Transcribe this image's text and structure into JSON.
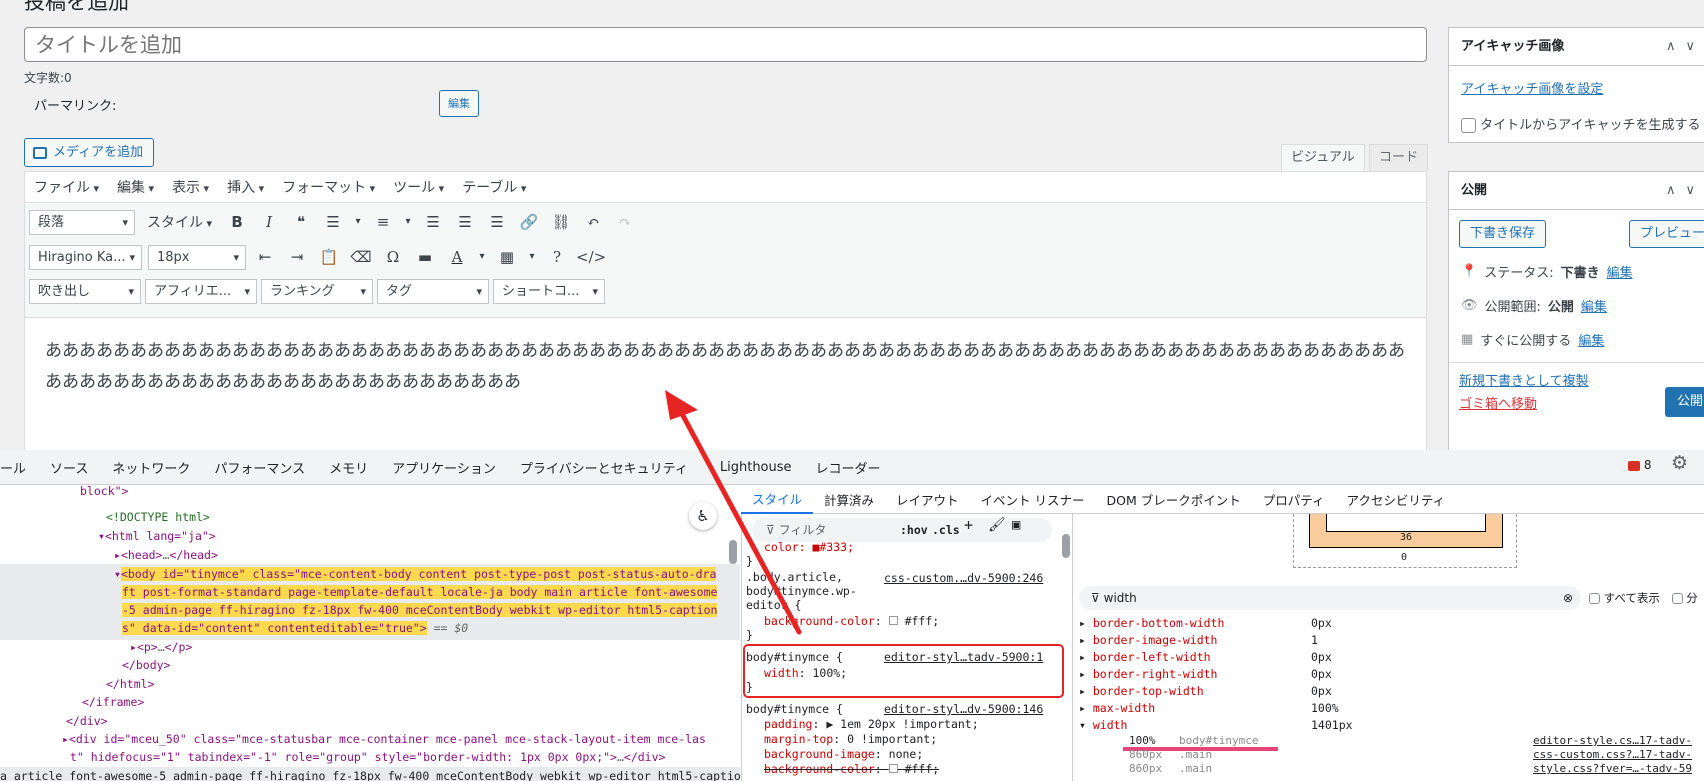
{
  "editor": {
    "heading": "投稿を追加",
    "title_placeholder": "タイトルを追加",
    "char_count": "文字数:0",
    "permalink_label": "パーマリンク:",
    "edit_button": "編集",
    "add_media": "メディアを追加",
    "tab_visual": "ビジュアル",
    "tab_code": "コード",
    "menu": [
      "ファイル",
      "編集",
      "表示",
      "挿入",
      "フォーマット",
      "ツール",
      "テーブル"
    ],
    "toolbar1": {
      "format_select": "段落",
      "style_dropdown": "スタイル"
    },
    "toolbar2": {
      "font_select": "Hiragino Ka...",
      "size_select": "18px"
    },
    "toolbar3": [
      "吹き出し",
      "アフィリエ...",
      "ランキング",
      "タグ",
      "ショートコ..."
    ],
    "content": "ああああああああああああああああああああああああああああああああああああああああああああああああああああああああああああああああああああああああああああああああああああああああああああああああああああああああああああ"
  },
  "sidebar": {
    "featured": {
      "title": "アイキャッチ画像",
      "set_link": "アイキャッチ画像を設定",
      "generate_label": "タイトルからアイキャッチを生成する"
    },
    "publish": {
      "title": "公開",
      "save_draft": "下書き保存",
      "preview": "プレビュー",
      "status_label": "ステータス:",
      "status_value": "下書き",
      "visibility_label": "公開範囲:",
      "visibility_value": "公開",
      "schedule_label": "すぐに公開する",
      "edit": "編集",
      "copy_draft": "新規下書きとして複製",
      "trash": "ゴミ箱へ移動",
      "publish_button": "公開"
    }
  },
  "devtools": {
    "tabs": [
      "ール",
      "ソース",
      "ネットワーク",
      "パフォーマンス",
      "メモリ",
      "アプリケーション",
      "プライバシーとセキュリティ",
      "Lighthouse",
      "レコーダー"
    ],
    "error_count": "8",
    "subtabs": [
      "スタイル",
      "計算済み",
      "レイアウト",
      "イベント リスナー",
      "DOM ブレークポイント",
      "プロパティ",
      "アクセシビリティ"
    ],
    "filter_placeholder": "フィルタ",
    "hov": ":hov",
    "cls": ".cls",
    "elements": {
      "top_partial": "block\">",
      "doctype": "<!DOCTYPE html>",
      "html_open": "<html lang=\"ja\">",
      "head": "<head>",
      "head_close": "</head>",
      "body_line1": "<body id=\"tinymce\" class=\"mce-content-body content post-type-post post-status-auto-dra",
      "body_line2": "ft post-format-standard page-template-default locale-ja body main article font-awesome",
      "body_line3": "-5 admin-page ff-hiragino fz-18px fw-400 mceContentBody webkit wp-editor html5-caption",
      "body_line4": "s\" data-id=\"content\" contenteditable=\"true\">",
      "body_sel": "== $0",
      "p_tag": "<p>",
      "p_close": "</p>",
      "body_close": "</body>",
      "html_close": "</html>",
      "iframe_close": "</iframe>",
      "div_close": "</div>",
      "status_line1": "<div id=\"mceu_50\" class=\"mce-statusbar mce-container mce-panel mce-stack-layout-item mce-las",
      "status_line2": "t\" hidefocus=\"1\" tabindex=\"-1\" role=\"group\" style=\"border-width: 1px 0px 0px;\">",
      "status_close": "</div>",
      "bottom_partial": "a article font-awesome-5 admin-page ff-hiragino fz-18px fw-400 mceContentBody webkit wp-editor html5-caption"
    },
    "styles": {
      "partial_top": "color: ■#333;",
      "rule1_sel": ".body.article, body#tinymce.wp-editor {",
      "rule1_src": "css-custom.…dv-5900:246",
      "rule1_prop": "background-color",
      "rule1_val": "#fff;",
      "rule2_sel": "body#tinymce {",
      "rule2_src": "editor-styl…tadv-5900:1",
      "rule2_prop": "width",
      "rule2_val": "100%;",
      "rule3_sel": "body#tinymce {",
      "rule3_src": "editor-styl…dv-5900:146",
      "rule3_props": [
        {
          "p": "padding",
          "v": "▶ 1em 20px !important;"
        },
        {
          "p": "margin-top",
          "v": "0 !important;"
        },
        {
          "p": "background-image",
          "v": "none;"
        },
        {
          "p": "background-color",
          "v": "#fff;"
        }
      ],
      "close": "}"
    },
    "computed": {
      "box_bottom": "36",
      "box_zero": "0",
      "filter_value": "width",
      "show_all": "すべて表示",
      "group": "分",
      "rows": [
        {
          "n": "border-bottom-width",
          "v": "0px"
        },
        {
          "n": "border-image-width",
          "v": "1"
        },
        {
          "n": "border-left-width",
          "v": "0px"
        },
        {
          "n": "border-right-width",
          "v": "0px"
        },
        {
          "n": "border-top-width",
          "v": "0px"
        },
        {
          "n": "max-width",
          "v": "100%"
        },
        {
          "n": "width",
          "v": "1401px"
        }
      ],
      "width_sources": [
        {
          "v": "100%",
          "s": "body#tinymce",
          "f": "editor-style.cs…17-tadv-"
        },
        {
          "v": "860px",
          "s": ".main",
          "f": "css-custom.css?…17-tadv-"
        },
        {
          "v": "860px",
          "s": ".main",
          "f": "style.css?fver=…-tadv-59"
        }
      ]
    }
  },
  "colors": {
    "accent": "#2271b1",
    "annotation": "#e62424",
    "highlight": "#fcd94e",
    "underline_pink": "#e6457a"
  }
}
